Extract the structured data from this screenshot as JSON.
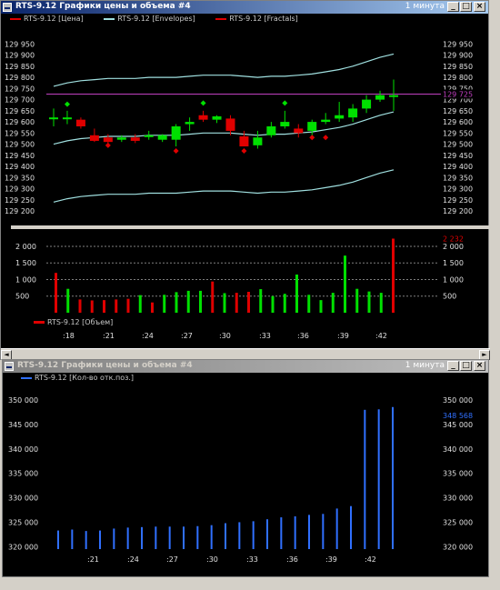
{
  "window1": {
    "title": "RTS-9.12 Графики цены и объема #4",
    "timeframe": "1 минута",
    "buttons": {
      "minimize": "_",
      "restore": "□",
      "close": "×"
    },
    "legend": [
      {
        "label": "RTS-9.12 [Цена]",
        "color": "#e00000"
      },
      {
        "label": "RTS-9.12 [Envelopes]",
        "color": "#a0e0e0"
      },
      {
        "label": "RTS-9.12 [Fractals]",
        "color": "#e00000"
      }
    ],
    "volume_legend": {
      "label": "RTS-9.12 [Объем]",
      "color": "#e00000"
    },
    "price_marker": "129 725"
  },
  "window2": {
    "title": "RTS-9.12 Графики цены и объема #4",
    "timeframe": "1 минута",
    "legend": {
      "label": "RTS-9.12 [Кол-во отк.поз.]",
      "color": "#3070ff"
    },
    "value_marker": "348 568"
  },
  "colors": {
    "up": "#00e000",
    "down": "#e00000",
    "envelope": "#a0e0e0",
    "level": "#c040c0",
    "oi": "#3070ff",
    "grid": "#808080"
  },
  "chart_data": [
    {
      "type": "candlestick",
      "title": "RTS-9.12 [Цена]",
      "y_ticks": [
        "129 950",
        "129 900",
        "129 850",
        "129 800",
        "129 750",
        "129 700",
        "129 650",
        "129 600",
        "129 550",
        "129 500",
        "129 450",
        "129 400",
        "129 350",
        "129 300",
        "129 250",
        "129 200"
      ],
      "ylim": [
        129180,
        129980
      ],
      "level_line": 129725,
      "candles": [
        {
          "o": 129620,
          "h": 129660,
          "l": 129580,
          "c": 129620
        },
        {
          "o": 129620,
          "h": 129650,
          "l": 129590,
          "c": 129620
        },
        {
          "o": 129610,
          "h": 129620,
          "l": 129570,
          "c": 129580
        },
        {
          "o": 129540,
          "h": 129570,
          "l": 129510,
          "c": 129515
        },
        {
          "o": 129530,
          "h": 129545,
          "l": 129500,
          "c": 129510
        },
        {
          "o": 129520,
          "h": 129540,
          "l": 129510,
          "c": 129530
        },
        {
          "o": 129530,
          "h": 129545,
          "l": 129505,
          "c": 129515
        },
        {
          "o": 129535,
          "h": 129560,
          "l": 129520,
          "c": 129540
        },
        {
          "o": 129520,
          "h": 129545,
          "l": 129510,
          "c": 129540
        },
        {
          "o": 129520,
          "h": 129590,
          "l": 129490,
          "c": 129580
        },
        {
          "o": 129590,
          "h": 129620,
          "l": 129560,
          "c": 129600
        },
        {
          "o": 129630,
          "h": 129650,
          "l": 129600,
          "c": 129610
        },
        {
          "o": 129610,
          "h": 129630,
          "l": 129595,
          "c": 129625
        },
        {
          "o": 129615,
          "h": 129630,
          "l": 129540,
          "c": 129560
        },
        {
          "o": 129535,
          "h": 129560,
          "l": 129500,
          "c": 129490
        },
        {
          "o": 129495,
          "h": 129560,
          "l": 129480,
          "c": 129530
        },
        {
          "o": 129540,
          "h": 129600,
          "l": 129530,
          "c": 129580
        },
        {
          "o": 129580,
          "h": 129650,
          "l": 129570,
          "c": 129600
        },
        {
          "o": 129570,
          "h": 129590,
          "l": 129530,
          "c": 129550
        },
        {
          "o": 129560,
          "h": 129610,
          "l": 129540,
          "c": 129600
        },
        {
          "o": 129600,
          "h": 129640,
          "l": 129590,
          "c": 129610
        },
        {
          "o": 129615,
          "h": 129690,
          "l": 129600,
          "c": 129630
        },
        {
          "o": 129620,
          "h": 129680,
          "l": 129600,
          "c": 129660
        },
        {
          "o": 129660,
          "h": 129720,
          "l": 129640,
          "c": 129700
        },
        {
          "o": 129700,
          "h": 129740,
          "l": 129690,
          "c": 129720
        },
        {
          "o": 129720,
          "h": 129790,
          "l": 129650,
          "c": 129720
        }
      ],
      "envelope_upper": [
        129760,
        129775,
        129785,
        129790,
        129795,
        129795,
        129795,
        129800,
        129800,
        129800,
        129805,
        129810,
        129810,
        129810,
        129805,
        129800,
        129805,
        129805,
        129810,
        129815,
        129825,
        129835,
        129850,
        129870,
        129890,
        129905
      ],
      "envelope_lower": [
        129500,
        129515,
        129525,
        129530,
        129535,
        129535,
        129535,
        129540,
        129540,
        129540,
        129545,
        129550,
        129550,
        129550,
        129545,
        129540,
        129545,
        129545,
        129550,
        129555,
        129565,
        129575,
        129590,
        129610,
        129630,
        129645
      ],
      "envelope_outer_lower": [
        129240,
        129255,
        129265,
        129270,
        129275,
        129275,
        129275,
        129280,
        129280,
        129280,
        129285,
        129290,
        129290,
        129290,
        129285,
        129280,
        129285,
        129285,
        129290,
        129295,
        129305,
        129315,
        129330,
        129350,
        129370,
        129385
      ],
      "fractals_up": [
        {
          "i": 1,
          "v": 129655
        },
        {
          "i": 11,
          "v": 129660
        },
        {
          "i": 17,
          "v": 129660
        }
      ],
      "fractals_down": [
        {
          "i": 4,
          "v": 129495
        },
        {
          "i": 9,
          "v": 129470
        },
        {
          "i": 14,
          "v": 129470
        },
        {
          "i": 19,
          "v": 129530
        },
        {
          "i": 20,
          "v": 129530
        }
      ]
    },
    {
      "type": "bar",
      "title": "RTS-9.12 [Объем]",
      "y_ticks": [
        "2 000",
        "1 500",
        "1 000",
        "500"
      ],
      "ylim": [
        0,
        2300
      ],
      "max_label": "2 232",
      "x_ticks": [
        ":18",
        ":21",
        ":24",
        ":27",
        ":30",
        ":33",
        ":36",
        ":39",
        ":42"
      ],
      "values": [
        1200,
        720,
        400,
        370,
        380,
        400,
        420,
        530,
        310,
        540,
        620,
        660,
        660,
        940,
        590,
        600,
        630,
        710,
        500,
        570,
        1150,
        540,
        380,
        600,
        1720,
        720,
        640,
        600,
        2232
      ],
      "colors": [
        "down",
        "up",
        "down",
        "down",
        "down",
        "down",
        "down",
        "up",
        "down",
        "up",
        "up",
        "up",
        "up",
        "down",
        "up",
        "down",
        "down",
        "up",
        "up",
        "up",
        "up",
        "up",
        "up",
        "up",
        "up",
        "up",
        "up",
        "up",
        "down"
      ]
    },
    {
      "type": "bar",
      "title": "RTS-9.12 [Кол-во отк.поз.]",
      "y_ticks": [
        "350 000",
        "345 000",
        "340 000",
        "335 000",
        "330 000",
        "325 000",
        "320 000"
      ],
      "ylim": [
        319500,
        351500
      ],
      "x_ticks": [
        ":21",
        ":24",
        ":27",
        ":30",
        ":33",
        ":36",
        ":39",
        ":42"
      ],
      "values": [
        323300,
        323500,
        323200,
        323300,
        323700,
        323900,
        324000,
        324100,
        324100,
        324100,
        324200,
        324400,
        324800,
        325000,
        325200,
        325600,
        326000,
        326200,
        326500,
        326700,
        327800,
        328300,
        348000,
        348100,
        348568
      ]
    }
  ]
}
